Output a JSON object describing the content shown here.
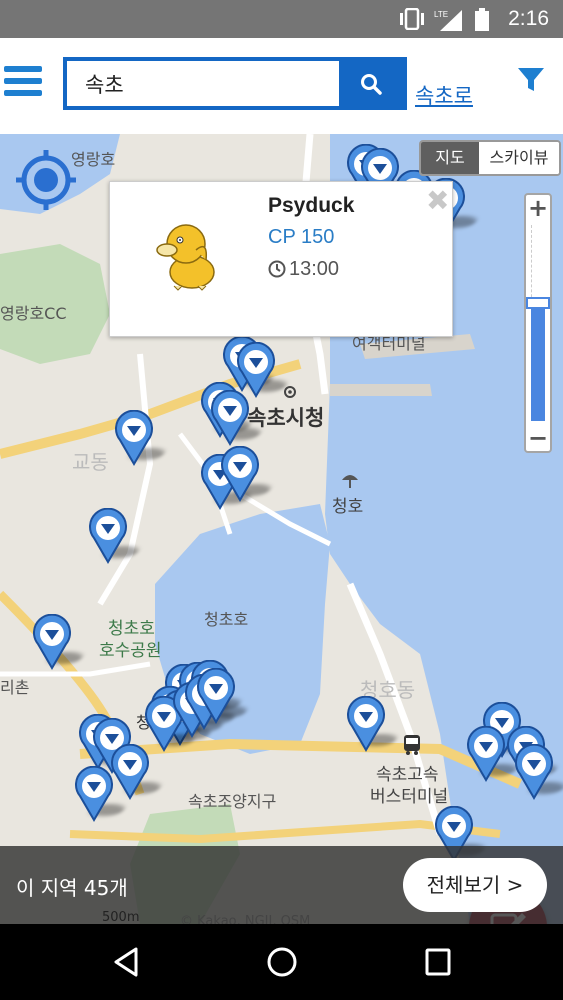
{
  "status_bar": {
    "time": "2:16",
    "network": "LTE",
    "icons": [
      "vibrate-icon",
      "lte-signal-icon",
      "battery-icon"
    ]
  },
  "search": {
    "value": "속초",
    "placeholder": "",
    "button_icon": "search-icon",
    "suggestion": "속초로"
  },
  "map": {
    "labels": {
      "yeongnangho": "영랑호",
      "golf": "영랑호CC",
      "city_hall": "속초시청",
      "cheongho": "청호",
      "cheongchoho": "청초호",
      "park_line1": "청초호",
      "park_line2": "호수공원",
      "school": "속초조양지구",
      "terminal_line1": "속초고속",
      "terminal_line2": "버스터미널",
      "ferry_terminal": "여객터미널",
      "resort": "리촌",
      "gyo": "교동",
      "cheongho_dong": "청호동",
      "janghak": "청",
      "scale": "500m",
      "copyright": "© Kakao, NGII, OSM"
    },
    "map_type": {
      "map": "지도",
      "skyview": "스카이뷰",
      "selected": "지도"
    },
    "zoom": {
      "in": "+",
      "out": "−",
      "level_fraction": 0.6
    }
  },
  "popup": {
    "name": "Psyduck",
    "cp": "CP 150",
    "time": "13:00",
    "close": "✖"
  },
  "bottom": {
    "count_text": "이 지역 45개",
    "view_all": "전체보기 >"
  },
  "colors": {
    "primary": "#1467c4",
    "fab": "#a31b2e",
    "pin": "#4a8fe0",
    "water": "#a9c8f0"
  }
}
